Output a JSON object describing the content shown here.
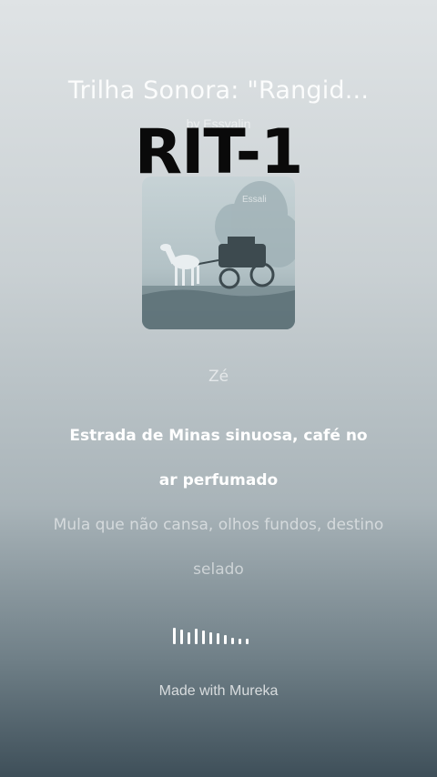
{
  "song": {
    "title": "Trilha Sonora: \"Rangid...",
    "artist": "by Essyalin"
  },
  "overlay_label": "RIT-1",
  "cover": {
    "description_icon": "horse-carriage-cover",
    "watermark": "Essali"
  },
  "lyrics": {
    "previous": "Zé",
    "current": "Estrada de Minas sinuosa, café no ar perfumado",
    "next": "Mula que não cansa, olhos fundos, destino selado"
  },
  "footer": {
    "made_with": "Made with Mureka"
  },
  "colors": {
    "text": "#ffffff",
    "overlay": "#0a0a0a"
  }
}
